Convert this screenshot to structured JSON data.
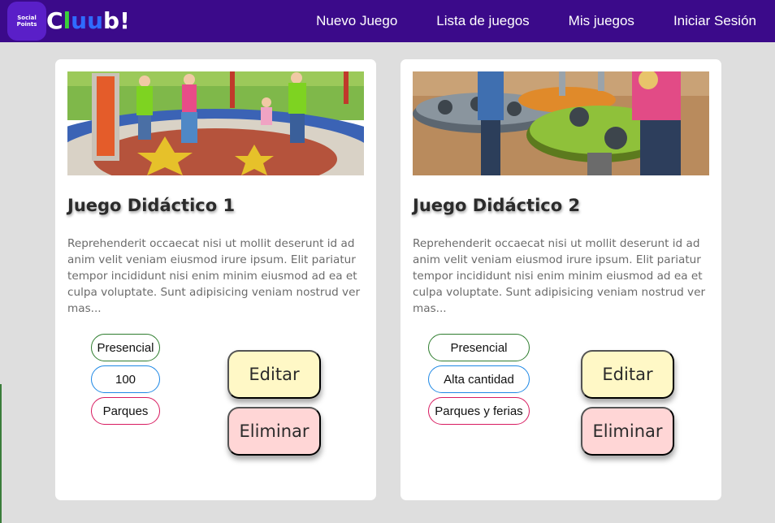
{
  "brand": {
    "badge_line1": "Social",
    "badge_line2": "Points",
    "wordmark": [
      "C",
      "l",
      "uu",
      "b!"
    ]
  },
  "nav": {
    "items": [
      "Nuevo Juego",
      "Lista de juegos",
      "Mis juegos",
      "Iniciar Sesión"
    ]
  },
  "cards": [
    {
      "title": "Juego Didáctico 1",
      "description": "Reprehenderit occaecat nisi ut mollit deserunt id ad anim velit veniam eiusmod irure ipsum. Elit pariatur tempor incididunt nisi enim minim eiusmod ad ea et culpa voluptate. Sunt adipisicing veniam nostrud ver mas...",
      "tags": [
        "Presencial",
        "100",
        "Parques"
      ],
      "edit_label": "Editar",
      "delete_label": "Eliminar"
    },
    {
      "title": "Juego Didáctico 2",
      "description": "Reprehenderit occaecat nisi ut mollit deserunt id ad anim velit veniam eiusmod irure ipsum. Elit pariatur tempor incididunt nisi enim minim eiusmod ad ea et culpa voluptate. Sunt adipisicing veniam nostrud ver mas...",
      "tags": [
        "Presencial",
        "Alta cantidad",
        "Parques y ferias"
      ],
      "edit_label": "Editar",
      "delete_label": "Eliminar"
    }
  ],
  "colors": {
    "navbar": "#3b0a8a",
    "logo_badge": "#5a1fc8",
    "background": "#dedede",
    "tag_modality_border": "#2e7d2e",
    "tag_quantity_border": "#1e88e5",
    "tag_place_border": "#d81b60",
    "edit_button": "#fff8c6",
    "delete_button": "#ffd6d6"
  }
}
